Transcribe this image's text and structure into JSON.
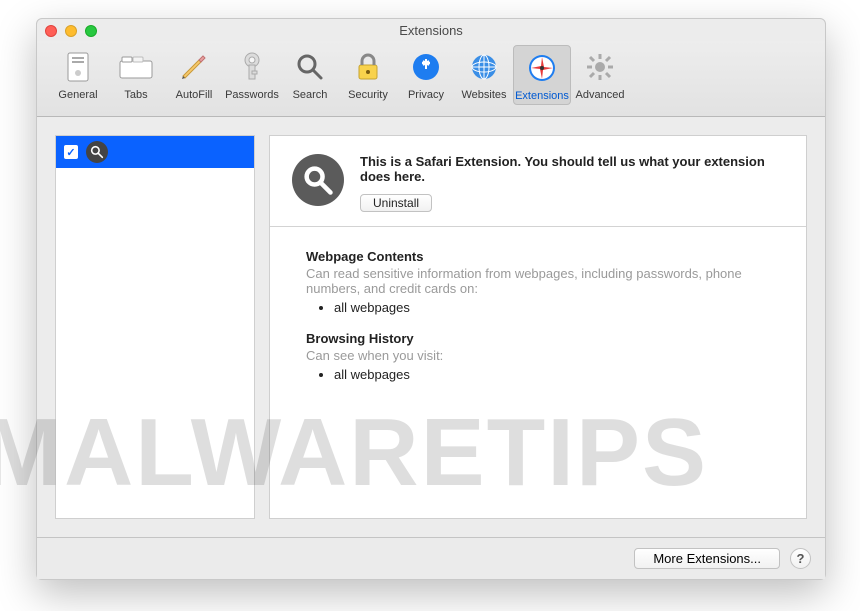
{
  "window": {
    "title": "Extensions"
  },
  "toolbar": {
    "items": [
      {
        "id": "general",
        "label": "General",
        "selected": false
      },
      {
        "id": "tabs",
        "label": "Tabs",
        "selected": false
      },
      {
        "id": "autofill",
        "label": "AutoFill",
        "selected": false
      },
      {
        "id": "passwords",
        "label": "Passwords",
        "selected": false
      },
      {
        "id": "search",
        "label": "Search",
        "selected": false
      },
      {
        "id": "security",
        "label": "Security",
        "selected": false
      },
      {
        "id": "privacy",
        "label": "Privacy",
        "selected": false
      },
      {
        "id": "websites",
        "label": "Websites",
        "selected": false
      },
      {
        "id": "extensions",
        "label": "Extensions",
        "selected": true
      },
      {
        "id": "advanced",
        "label": "Advanced",
        "selected": false
      }
    ]
  },
  "sidebar": {
    "items": [
      {
        "enabled": true,
        "icon": "search-icon"
      }
    ]
  },
  "detail": {
    "description": "This is a Safari Extension. You should tell us what your extension does here.",
    "uninstall_label": "Uninstall",
    "sections": [
      {
        "title": "Webpage Contents",
        "desc": "Can read sensitive information from webpages, including passwords, phone numbers, and credit cards on:",
        "items": [
          "all webpages"
        ]
      },
      {
        "title": "Browsing History",
        "desc": "Can see when you visit:",
        "items": [
          "all webpages"
        ]
      }
    ]
  },
  "footer": {
    "more_label": "More Extensions...",
    "help_label": "?"
  },
  "watermark": "MALWARETIPS"
}
